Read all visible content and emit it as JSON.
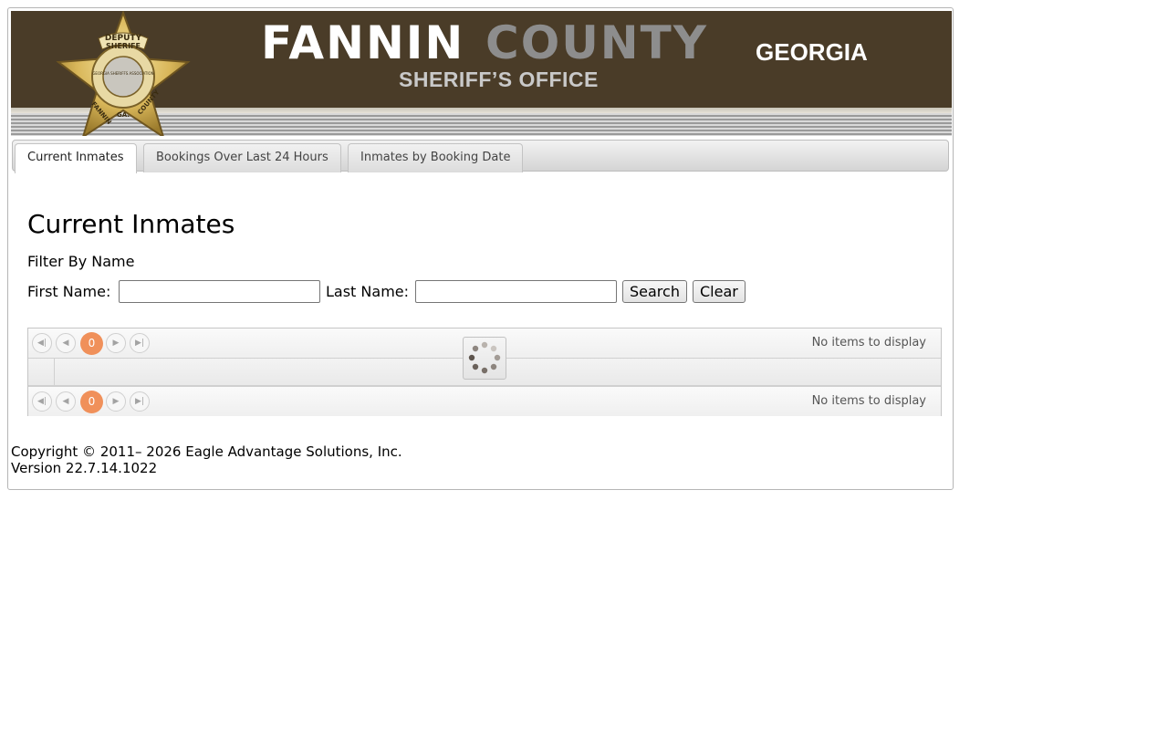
{
  "banner": {
    "brand_word1": "FANNIN",
    "brand_word2": "COUNTY",
    "state": "GEORGIA",
    "subtitle": "SHERIFF’S OFFICE",
    "badge_text_top": "DEPUTY",
    "badge_text_ribbon": "SHERIFF",
    "badge_text_left": "FANNIN",
    "badge_text_mid": "GA.",
    "badge_text_right": "COUNTY",
    "badge_seal_text": "GEORGIA SHERIFFS ASSOCIATION"
  },
  "tabs": [
    {
      "label": "Current Inmates",
      "active": true
    },
    {
      "label": "Bookings Over Last 24 Hours",
      "active": false
    },
    {
      "label": "Inmates by Booking Date",
      "active": false
    }
  ],
  "main": {
    "title": "Current Inmates",
    "filter_label": "Filter By Name",
    "first_name_label": "First Name:",
    "first_name_value": "",
    "last_name_label": "Last Name:",
    "last_name_value": "",
    "search_label": "Search",
    "clear_label": "Clear"
  },
  "grid": {
    "top_pager": {
      "page": "0",
      "info": "No items to display"
    },
    "bottom_pager": {
      "page": "0",
      "info": "No items to display"
    },
    "loading": true
  },
  "footer": {
    "copyright": "Copyright © 2011– 2026 Eagle Advantage Solutions, Inc.",
    "version": "Version 22.7.14.1022"
  },
  "colors": {
    "banner_bg": "#4a3c28",
    "brand_gray": "#8d8d8d",
    "pager_active": "#f0905a"
  },
  "icons": {
    "first_page": "first-page-icon",
    "prev_page": "prev-page-icon",
    "next_page": "next-page-icon",
    "last_page": "last-page-icon",
    "loading": "spinner-icon",
    "badge": "sheriff-badge-logo"
  }
}
